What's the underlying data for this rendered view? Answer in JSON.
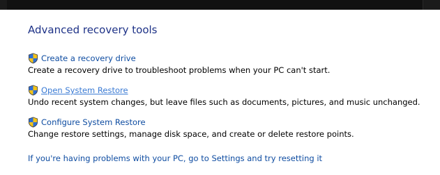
{
  "colors": {
    "heading": "#1e3287",
    "link": "#0e4ca1",
    "link_hover": "#3b7bd4",
    "top_strip": "#111111"
  },
  "section": {
    "heading": "Advanced recovery tools"
  },
  "tools": [
    {
      "icon": "uac-shield-icon",
      "link": "Create a recovery drive",
      "description": "Create a recovery drive to troubleshoot problems when your PC can't start."
    },
    {
      "icon": "uac-shield-icon",
      "link": "Open System Restore",
      "description": "Undo recent system changes, but leave files such as documents, pictures, and music unchanged.",
      "hovered": true
    },
    {
      "icon": "uac-shield-icon",
      "link": "Configure System Restore",
      "description": "Change restore settings, manage disk space, and create or delete restore points."
    }
  ],
  "footer": {
    "reset_link": "If you're having problems with your PC, go to Settings and try resetting it"
  }
}
